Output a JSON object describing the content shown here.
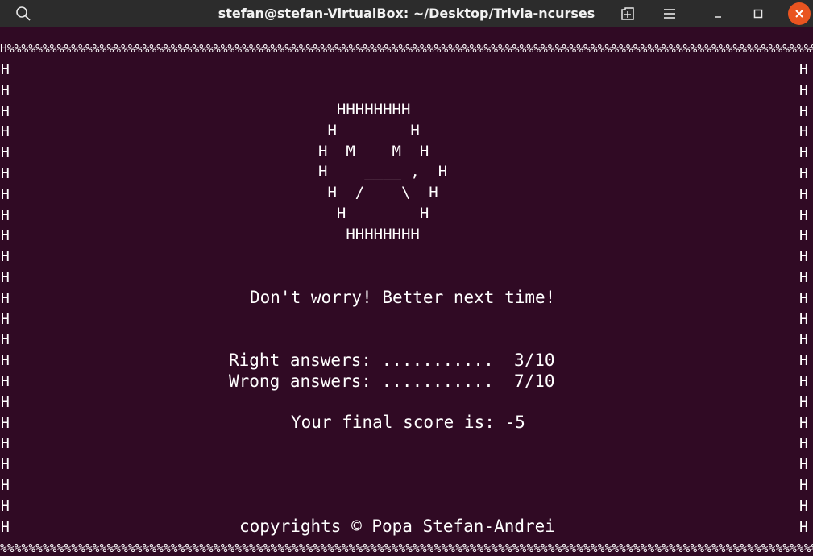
{
  "window": {
    "title": "stefan@stefan-VirtualBox: ~/Desktop/Trivia-ncurses"
  },
  "terminal": {
    "border_top": "H%%%%%%%%%%%%%%%%%%%%%%%%%%%%%%%%%%%%%%%%%%%%%%%%%%%%%%%%%%%%%%%%%%%%%%%%%%%%%%%%%%%%%%%%%%%%%%%%%%%%%%%%%%%%%%%%%%%%%%%%%%%%%%%%%%%%%%%%%%%%%%%%%H",
    "border_bottom": "%%%%%%%%%%%%%%%%%%%%%%%%%%%%%%%%%%%%%%%%%%%%%%%%%%%%%%%%%%%%%%%%%%%%%%%%%%%%%%%%%%%%%%%%%%%%%%%%%%%%%%%%%%%%%%%%%%%%%%%%%%%%%%%%%%%%%%%%%%%%%%%%%%%%",
    "border_side": "H\nH\nH\nH\nH\nH\nH\nH\nH\nH\nH\nH\nH\nH\nH\nH\nH\nH\nH\nH\nH\nH\nH",
    "face_art": "  HHHHHHHH\n H        H\nH  M    M  H\nH    ____ ,  H\n H  /    \\  H\n  H        H\n   HHHHHHHH",
    "message": "Don't worry! Better next time!",
    "right_answers": "Right answers: ...........  3/10",
    "wrong_answers": "Wrong answers: ...........  7/10",
    "final_score": "Your final score is: -5",
    "copyright": "copyrights © Popa Stefan-Andrei"
  },
  "icons": {
    "search": "search-icon",
    "new_tab": "new-tab-icon",
    "menu": "hamburger-menu-icon",
    "minimize": "minimize-icon",
    "maximize": "maximize-icon",
    "close": "close-icon"
  },
  "colors": {
    "terminal_bg": "#300a24",
    "titlebar_bg": "#2c2c2c",
    "close_button": "#e95420",
    "text": "#ffffff"
  }
}
